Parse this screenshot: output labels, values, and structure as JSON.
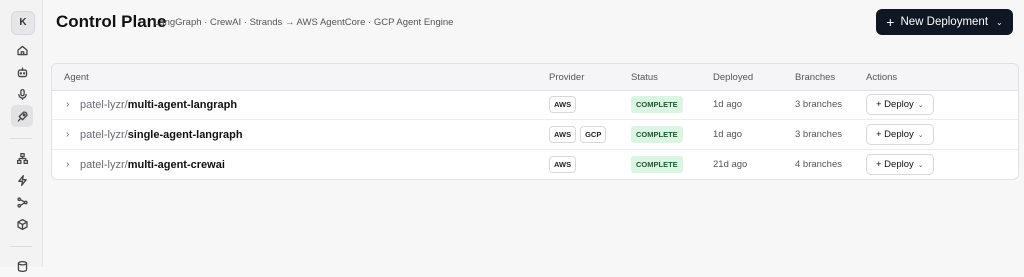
{
  "sidebar": {
    "avatar_initial": "K",
    "items": [
      {
        "icon": "home-icon"
      },
      {
        "icon": "bot-icon"
      },
      {
        "icon": "microphone-icon"
      },
      {
        "icon": "rocket-icon",
        "active": true
      },
      {
        "icon": "network-icon"
      },
      {
        "icon": "lightning-icon"
      },
      {
        "icon": "workflow-icon"
      },
      {
        "icon": "box-icon"
      },
      {
        "icon": "database-icon"
      }
    ]
  },
  "header": {
    "title": "Control Plane",
    "subtitle": "LangGraph · CrewAI · Strands → AWS AgentCore · GCP Agent Engine",
    "new_button": {
      "icon": "+",
      "label": "New Deployment",
      "chevron": "⌄"
    }
  },
  "table": {
    "columns": {
      "agent": "Agent",
      "provider": "Provider",
      "status": "Status",
      "deployed": "Deployed",
      "branches": "Branches",
      "actions": "Actions"
    },
    "rows": [
      {
        "expander": "›",
        "org": "patel-lyzr",
        "name": "multi-agent-langraph",
        "providers": [
          "AWS"
        ],
        "status": "COMPLETE",
        "deployed": "1d ago",
        "branches": "3 branches",
        "action_label": "+ Deploy"
      },
      {
        "expander": "›",
        "org": "patel-lyzr",
        "name": "single-agent-langraph",
        "providers": [
          "AWS",
          "GCP"
        ],
        "status": "COMPLETE",
        "deployed": "1d ago",
        "branches": "3 branches",
        "action_label": "+ Deploy"
      },
      {
        "expander": "›",
        "org": "patel-lyzr",
        "name": "multi-agent-crewai",
        "providers": [
          "AWS"
        ],
        "status": "COMPLETE",
        "deployed": "21d ago",
        "branches": "4 branches",
        "action_label": "+ Deploy"
      }
    ],
    "slash": "/",
    "dropdown_chevron": "⌄"
  },
  "colors": {
    "primary_button": "#0f1624",
    "status_complete_bg": "#dcf5e3",
    "status_complete_text": "#1d5a33",
    "background": "#f7f7f8"
  }
}
